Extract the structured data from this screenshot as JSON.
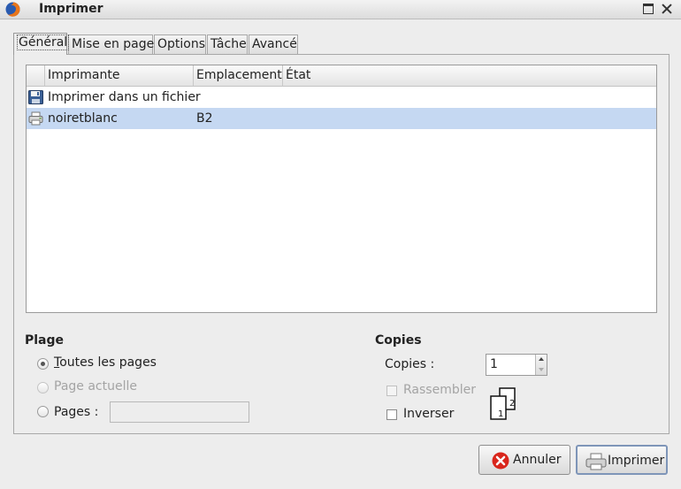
{
  "window": {
    "title": "Imprimer",
    "icon": "firefox-icon"
  },
  "tabs": [
    {
      "label": "Général",
      "active": true
    },
    {
      "label": "Mise en page",
      "active": false
    },
    {
      "label": "Options",
      "active": false
    },
    {
      "label": "Tâche",
      "active": false
    },
    {
      "label": "Avancé",
      "active": false
    }
  ],
  "printer_list": {
    "columns": [
      "Imprimante",
      "Emplacement",
      "État"
    ],
    "rows": [
      {
        "icon": "floppy-disk-icon",
        "name": "Imprimer dans un fichier",
        "location": "",
        "state": "",
        "selected": false
      },
      {
        "icon": "printer-icon",
        "name": "noiretblanc",
        "location": "B2",
        "state": "",
        "selected": true
      }
    ]
  },
  "range": {
    "title": "Plage",
    "all_pages": "Toutes les pages",
    "current_page": "Page actuelle",
    "pages_label": "Pages :",
    "pages_value": "",
    "selected": "all_pages"
  },
  "copies": {
    "title": "Copies",
    "copies_label": "Copies :",
    "copies_value": "1",
    "collate_label": "Rassembler",
    "collate_checked": false,
    "collate_enabled": false,
    "reverse_label": "Inverser",
    "reverse_checked": false,
    "collate_page_numbers": [
      "1",
      "2"
    ]
  },
  "buttons": {
    "cancel": "Annuler",
    "print": "Imprimer"
  },
  "colors": {
    "selection": "#c5d8f2",
    "cancel_icon": "#d9261c",
    "default_button_border": "#7e95b8"
  }
}
